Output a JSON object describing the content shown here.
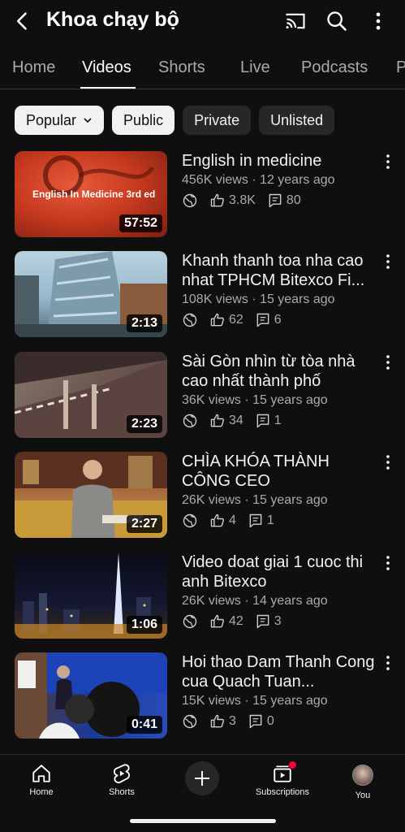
{
  "header": {
    "title": "Khoa chạy bộ"
  },
  "tabs": [
    {
      "label": "Home"
    },
    {
      "label": "Videos"
    },
    {
      "label": "Shorts"
    },
    {
      "label": "Live"
    },
    {
      "label": "Podcasts"
    },
    {
      "label": "P"
    }
  ],
  "chips": [
    {
      "label": "Popular"
    },
    {
      "label": "Public"
    },
    {
      "label": "Private"
    },
    {
      "label": "Unlisted"
    }
  ],
  "videos": [
    {
      "title": "English in medicine",
      "meta": "456K views · 12 years ago",
      "likes": "3.8K",
      "comments": "80",
      "duration": "57:52",
      "thumb_text": "English In Medicine 3rd ed"
    },
    {
      "title": "Khanh thanh toa nha cao nhat TPHCM Bitexco Fi...",
      "meta": "108K views · 15 years ago",
      "likes": "62",
      "comments": "6",
      "duration": "2:13"
    },
    {
      "title": "Sài Gòn nhìn từ tòa nhà cao nhất thành phố",
      "meta": "36K views · 15 years ago",
      "likes": "34",
      "comments": "1",
      "duration": "2:23"
    },
    {
      "title": "CHÌA KHÓA THÀNH CÔNG  CEO",
      "meta": "26K views · 15 years ago",
      "likes": "4",
      "comments": "1",
      "duration": "2:27"
    },
    {
      "title": "Video doat giai 1 cuoc thi anh Bitexco",
      "meta": "26K views · 14 years ago",
      "likes": "42",
      "comments": "3",
      "duration": "1:06"
    },
    {
      "title": "Hoi thao Dam Thanh Cong cua Quach Tuan...",
      "meta": "15K views · 15 years ago",
      "likes": "3",
      "comments": "0",
      "duration": "0:41"
    }
  ],
  "bottom_nav": {
    "home": "Home",
    "shorts": "Shorts",
    "subscriptions": "Subscriptions",
    "you": "You"
  },
  "colors": {
    "background": "#0f0f0f",
    "notification": "#ff0033"
  }
}
